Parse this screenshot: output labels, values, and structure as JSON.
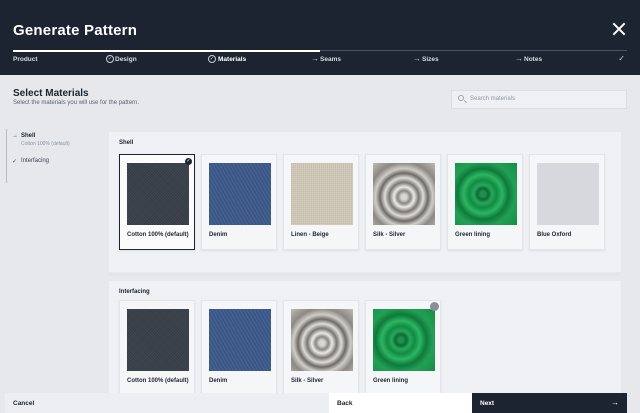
{
  "header": {
    "title": "Generate Pattern",
    "steps": [
      {
        "label": "Product",
        "status": "done"
      },
      {
        "label": "Design",
        "status": "done"
      },
      {
        "label": "Materials",
        "status": "current"
      },
      {
        "label": "Seams",
        "status": "upcoming"
      },
      {
        "label": "Sizes",
        "status": "upcoming"
      },
      {
        "label": "Notes",
        "status": "check"
      }
    ],
    "progress_fraction": 0.5
  },
  "section": {
    "title": "Select Materials",
    "subtitle": "Select the materials you will use for the pattern."
  },
  "search": {
    "placeholder": "Search materials"
  },
  "sidenav": {
    "items": [
      {
        "label": "Shell",
        "sub": "Cotton 100% (default)",
        "icon": "arrow-right-icon"
      },
      {
        "label": "Interfacing",
        "icon": "check-icon"
      }
    ]
  },
  "groups": {
    "shell": {
      "title": "Shell",
      "materials": [
        {
          "name": "Cotton 100% (default)",
          "swatch": "cotton",
          "selected": true
        },
        {
          "name": "Denim",
          "swatch": "denim"
        },
        {
          "name": "Linen - Beige",
          "swatch": "linen"
        },
        {
          "name": "Silk - Silver",
          "swatch": "silk"
        },
        {
          "name": "Green lining",
          "swatch": "green"
        },
        {
          "name": "Blue Oxford",
          "swatch": "oxford"
        }
      ]
    },
    "interfacing": {
      "title": "Interfacing",
      "materials": [
        {
          "name": "Cotton 100% (default)",
          "swatch": "cotton"
        },
        {
          "name": "Denim",
          "swatch": "denim"
        },
        {
          "name": "Silk - Silver",
          "swatch": "silk"
        },
        {
          "name": "Green lining",
          "swatch": "green",
          "indicator": true
        }
      ]
    }
  },
  "footer": {
    "cancel": "Cancel",
    "back": "Back",
    "next": "Next"
  },
  "colors": {
    "header_bg": "#1b2430",
    "accent": "#1d2530",
    "page_bg": "#e6e8ec"
  }
}
